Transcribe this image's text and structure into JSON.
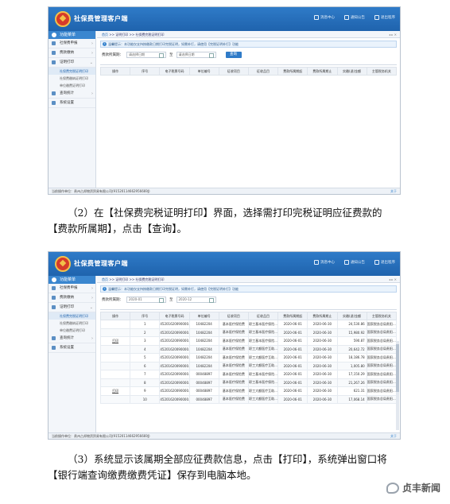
{
  "app": {
    "title": "社保费管理客户端",
    "topnav": [
      "消息中心",
      "通知公告",
      "退出程序"
    ]
  },
  "sidebar": {
    "header": "功能菜单",
    "items": [
      {
        "label": "社保费申报",
        "chev": "›"
      },
      {
        "label": "费款缴纳",
        "chev": "›"
      },
      {
        "label": "证明打印",
        "chev": "⌄"
      }
    ],
    "subitems": [
      "社保费完税证明打印",
      "社保费缴纳证明打印",
      "单位缴费证明打印"
    ],
    "items_after": [
      {
        "label": "查询统计",
        "chev": "›"
      },
      {
        "label": "系统设置",
        "chev": ""
      }
    ]
  },
  "statusbar": {
    "text": "当前操作单位：贵州占邦物资贸易有限公司(91520114662956669J)",
    "right": "关于"
  },
  "breadcrumb": {
    "home": "首页",
    "trail": ">> 证明打印 >> 社保费完税证明打印",
    "win": "◂ ▸ ✕"
  },
  "notice": "温馨提示：本功能仅支持按缴款日期打印完税证明，如需补打，请使用【完税证明补打】功能",
  "filters": {
    "period_label": "费款所属期：",
    "to": "至",
    "query": "查询"
  },
  "shot1": {
    "start_placeholder": "请选择日期",
    "end_placeholder": "请选择日期",
    "columns": [
      "操作",
      "序号",
      "电子税票号码",
      "单位编号",
      "征收项目",
      "征收品目",
      "费款所属期起",
      "费款所属期止",
      "实缴(退)金额",
      "主管税务机关"
    ]
  },
  "shot2": {
    "start_value": "2020-01",
    "end_value": "2020-12",
    "columns": [
      "操作",
      "序号",
      "电子税票号码",
      "单位编号",
      "征收项目",
      "征收品目",
      "费款所属期起",
      "费款所属期止",
      "实缴(退)金额",
      "主管税务机关"
    ],
    "print_label": "打印",
    "rows": [
      {
        "op": "",
        "no": "1",
        "ticket": "45201620090000...",
        "unit": "10482204",
        "item": "基本医疗保险费",
        "sub": "职工基本医疗保险...",
        "start": "2020-06-01",
        "end": "2020-06-30",
        "amount": "24,530.86",
        "office": "国家税务总局贵阳..."
      },
      {
        "op": "",
        "no": "2",
        "ticket": "45201620090000...",
        "unit": "10482204",
        "item": "基本医疗保险费",
        "sub": "职工基本医疗保险...",
        "start": "2020-06-01",
        "end": "2020-06-30",
        "amount": "15,980.92",
        "office": "国家税务总局贵阳..."
      },
      {
        "op": "打印",
        "no": "3",
        "ticket": "45201620090000...",
        "unit": "10482204",
        "item": "基本医疗保险费",
        "sub": "职工基本医疗保险...",
        "start": "2020-06-01",
        "end": "2020-06-30",
        "amount": "590.87",
        "office": "国家税务总局贵阳..."
      },
      {
        "op": "",
        "no": "4",
        "ticket": "45201620090000...",
        "unit": "10482204",
        "item": "基本医疗保险费",
        "sub": "职工大额医疗互助...",
        "start": "2020-06-01",
        "end": "2020-06-30",
        "amount": "20,642.72",
        "office": "国家税务总局贵阳..."
      },
      {
        "op": "",
        "no": "5",
        "ticket": "45201620090000...",
        "unit": "10482204",
        "item": "基本医疗保险费",
        "sub": "职工大额医疗互助...",
        "start": "2020-06-01",
        "end": "2020-06-30",
        "amount": "18,186.78",
        "office": "国家税务总局贵阳..."
      },
      {
        "op": "",
        "no": "6",
        "ticket": "45201620090000...",
        "unit": "10482204",
        "item": "基本医疗保险费",
        "sub": "职工大额医疗互助...",
        "start": "2020-06-01",
        "end": "2020-06-30",
        "amount": "1,005.80",
        "office": "国家税务总局贵阳..."
      },
      {
        "op": "",
        "no": "7",
        "ticket": "45201620090000...",
        "unit": "00048897",
        "item": "基本医疗保险费",
        "sub": "职工基本医疗保险...",
        "start": "2020-06-01",
        "end": "2020-06-30",
        "amount": "17,150.29",
        "office": "国家税务总局贵阳..."
      },
      {
        "op": "",
        "no": "8",
        "ticket": "45201620090000...",
        "unit": "00048897",
        "item": "基本医疗保险费",
        "sub": "职工基本医疗保险...",
        "start": "2020-06-01",
        "end": "2020-06-30",
        "amount": "21,267.26",
        "office": "国家税务总局贵阳..."
      },
      {
        "op": "打印",
        "no": "9",
        "ticket": "45201620090000...",
        "unit": "00048897",
        "item": "基本医疗保险费",
        "sub": "职工大额医疗互助...",
        "start": "2020-06-01",
        "end": "2020-06-30",
        "amount": "621.31",
        "office": "国家税务总局贵阳..."
      },
      {
        "op": "",
        "no": "10",
        "ticket": "45201620090000...",
        "unit": "00048897",
        "item": "基本医疗保险费",
        "sub": "职工大额医疗互助...",
        "start": "2020-06-01",
        "end": "2020-06-30",
        "amount": "17,068.14",
        "office": "国家税务总局贵阳..."
      }
    ]
  },
  "paragraphs": {
    "p1": "（2）在【社保费完税证明打印】界面，选择需打印完税证明应征费款的【费款所属期】，点击【查询】。",
    "p2": "（3）系统显示该属期全部应征费款信息，点击【打印】，系统弹出窗口将【银行端查询缴费缴费凭证】保存到电脑本地。"
  },
  "watermark": "贞丰新闻"
}
